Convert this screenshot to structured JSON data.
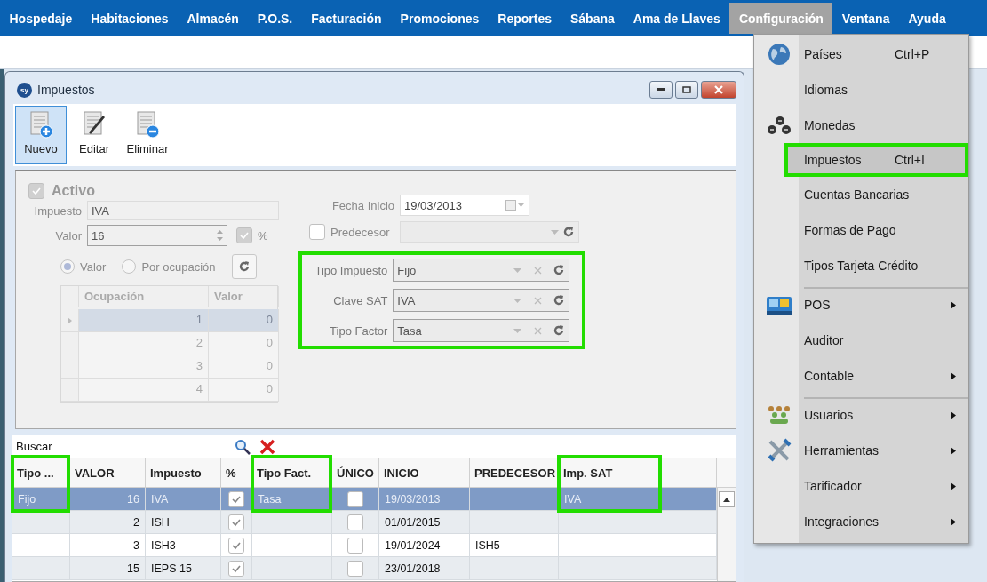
{
  "menubar": [
    {
      "label": "Hospedaje",
      "selected": false
    },
    {
      "label": "Habitaciones",
      "selected": false
    },
    {
      "label": "Almacén",
      "selected": false
    },
    {
      "label": "P.O.S.",
      "selected": false
    },
    {
      "label": "Facturación",
      "selected": false
    },
    {
      "label": "Promociones",
      "selected": false
    },
    {
      "label": "Reportes",
      "selected": false
    },
    {
      "label": "Sábana",
      "selected": false
    },
    {
      "label": "Ama de Llaves",
      "selected": false
    },
    {
      "label": "Configuración",
      "selected": true
    },
    {
      "label": "Ventana",
      "selected": false
    },
    {
      "label": "Ayuda",
      "selected": false
    }
  ],
  "window": {
    "title": "Impuestos",
    "badge": "sy"
  },
  "toolbar": [
    {
      "label": "Nuevo",
      "selected": true
    },
    {
      "label": "Editar",
      "selected": false
    },
    {
      "label": "Eliminar",
      "selected": false
    }
  ],
  "form": {
    "activo": {
      "label": "Activo",
      "checked": true
    },
    "impuesto": {
      "label": "Impuesto",
      "value": "IVA"
    },
    "valor": {
      "label": "Valor",
      "value": "16",
      "percent_checked": true,
      "percent_label": "%"
    },
    "radios": [
      {
        "label": "Valor",
        "selected": true
      },
      {
        "label": "Por ocupación",
        "selected": false
      }
    ],
    "occupancy": {
      "columns": [
        "Ocupación",
        "Valor"
      ],
      "rows": [
        {
          "ocupacion": "1",
          "valor": "0",
          "selected": true
        },
        {
          "ocupacion": "2",
          "valor": "0",
          "selected": false
        },
        {
          "ocupacion": "3",
          "valor": "0",
          "selected": false
        },
        {
          "ocupacion": "4",
          "valor": "0",
          "selected": false
        }
      ]
    },
    "fecha_inicio": {
      "label": "Fecha Inicio",
      "value": "19/03/2013"
    },
    "predecesor": {
      "label": "Predecesor",
      "checked": false
    },
    "combos": {
      "highlighted": true,
      "items": [
        {
          "label": "Tipo Impuesto",
          "value": "Fijo"
        },
        {
          "label": "Clave SAT",
          "value": "IVA"
        },
        {
          "label": "Tipo Factor",
          "value": "Tasa"
        }
      ]
    }
  },
  "search": {
    "placeholder": "Buscar"
  },
  "table": {
    "columns": [
      {
        "label": "Tipo ...",
        "highlighted": true
      },
      {
        "label": "VALOR",
        "highlighted": false
      },
      {
        "label": "Impuesto",
        "highlighted": false
      },
      {
        "label": "%",
        "highlighted": false
      },
      {
        "label": "Tipo Fact.",
        "highlighted": true
      },
      {
        "label": "ÚNICO",
        "highlighted": false
      },
      {
        "label": "INICIO",
        "highlighted": false
      },
      {
        "label": "PREDECESOR",
        "highlighted": false
      },
      {
        "label": "Imp. SAT",
        "highlighted": true
      }
    ],
    "rows": [
      {
        "tipo": "Fijo",
        "valor": "16",
        "impuesto": "IVA",
        "percent": true,
        "tipo_fact": "Tasa",
        "unico": false,
        "inicio": "19/03/2013",
        "predecesor": "",
        "imp_sat": "IVA",
        "selected": true
      },
      {
        "tipo": "",
        "valor": "2",
        "impuesto": "ISH",
        "percent": true,
        "tipo_fact": "",
        "unico": false,
        "inicio": "01/01/2015",
        "predecesor": "",
        "imp_sat": "",
        "selected": false
      },
      {
        "tipo": "",
        "valor": "3",
        "impuesto": "ISH3",
        "percent": true,
        "tipo_fact": "",
        "unico": false,
        "inicio": "19/01/2024",
        "predecesor": "ISH5",
        "imp_sat": "",
        "selected": false
      },
      {
        "tipo": "",
        "valor": "15",
        "impuesto": "IEPS 15",
        "percent": true,
        "tipo_fact": "",
        "unico": false,
        "inicio": "23/01/2018",
        "predecesor": "",
        "imp_sat": "",
        "selected": false
      }
    ]
  },
  "menu": [
    {
      "label": "Países",
      "shortcut": "Ctrl+P",
      "submenu": false,
      "selected": false,
      "highlighted": false,
      "separator_before": false
    },
    {
      "label": "Idiomas",
      "submenu": false,
      "selected": false,
      "highlighted": false,
      "separator_before": false
    },
    {
      "label": "Monedas",
      "submenu": false,
      "selected": false,
      "highlighted": false,
      "separator_before": false
    },
    {
      "label": "Impuestos",
      "shortcut": "Ctrl+I",
      "submenu": false,
      "selected": true,
      "highlighted": true,
      "separator_before": false
    },
    {
      "label": "Cuentas Bancarias",
      "submenu": false,
      "selected": false,
      "highlighted": false,
      "separator_before": false
    },
    {
      "label": "Formas de Pago",
      "submenu": false,
      "selected": false,
      "highlighted": false,
      "separator_before": false
    },
    {
      "label": "Tipos Tarjeta Crédito",
      "submenu": false,
      "selected": false,
      "highlighted": false,
      "separator_before": false
    },
    {
      "label": "POS",
      "submenu": true,
      "selected": false,
      "highlighted": false,
      "separator_before": true
    },
    {
      "label": "Auditor",
      "submenu": false,
      "selected": false,
      "highlighted": false,
      "separator_before": false
    },
    {
      "label": "Contable",
      "submenu": true,
      "selected": false,
      "highlighted": false,
      "separator_before": false
    },
    {
      "label": "Usuarios",
      "submenu": true,
      "selected": false,
      "highlighted": false,
      "separator_before": true
    },
    {
      "label": "Herramientas",
      "submenu": true,
      "selected": false,
      "highlighted": false,
      "separator_before": false
    },
    {
      "label": "Tarificador",
      "submenu": true,
      "selected": false,
      "highlighted": false,
      "separator_before": false
    },
    {
      "label": "Integraciones",
      "submenu": true,
      "selected": false,
      "highlighted": false,
      "separator_before": false
    }
  ]
}
